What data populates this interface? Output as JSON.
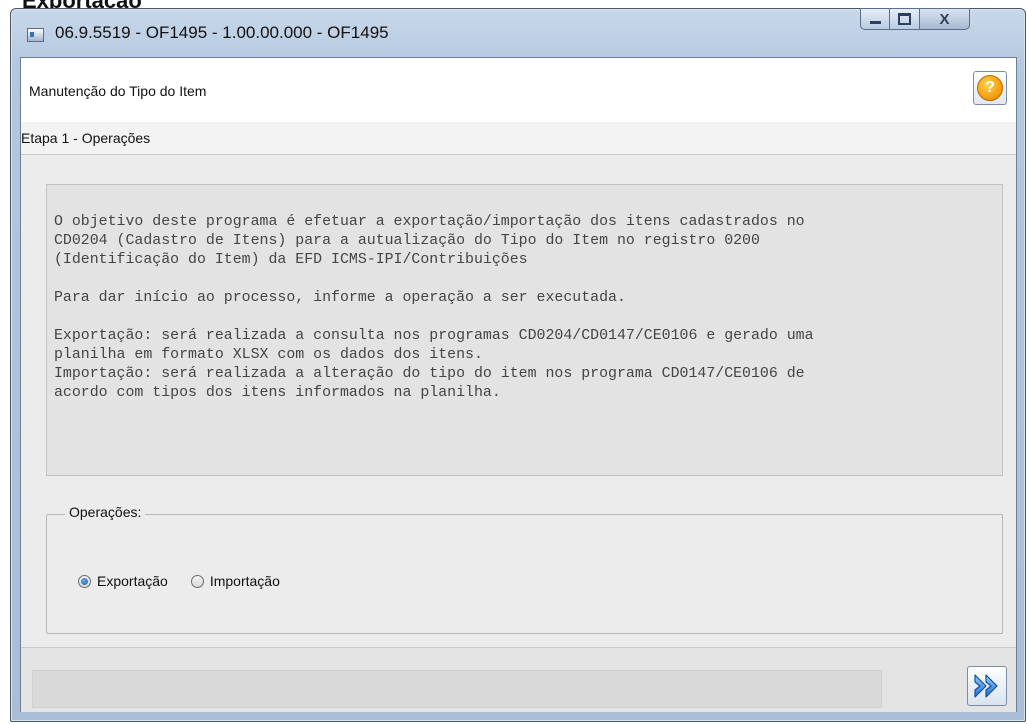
{
  "window": {
    "title": "06.9.5519 - OF1495 - 1.00.00.000 - OF1495",
    "minimize_glyph": "—",
    "maximize_glyph": "□",
    "close_glyph": "X"
  },
  "header": {
    "title": "Manutenção do Tipo do Item",
    "help_glyph": "?"
  },
  "step": {
    "label": "Etapa 1 - Operações"
  },
  "description": {
    "text": "O objetivo deste programa é efetuar a exportação/importação dos itens cadastrados no\nCD0204 (Cadastro de Itens) para a autualização do Tipo do Item no registro 0200\n(Identificação do Item) da EFD ICMS-IPI/Contribuições\n\nPara dar início ao processo, informe a operação a ser executada.\n\nExportação: será realizada a consulta nos programas CD0204/CD0147/CE0106 e gerado uma\nplanilha em formato XLSX com os dados dos itens.\nImportação: será realizada a alteração do tipo do item nos programa CD0147/CE0106 de\nacordo com tipos dos itens informados na planilha."
  },
  "operations": {
    "legend": "Operações:",
    "options": [
      {
        "label": "Exportação",
        "selected": true
      },
      {
        "label": "Importação",
        "selected": false
      }
    ]
  },
  "footer": {
    "status_text": ""
  },
  "colors": {
    "accent": "#1c5fb0",
    "help_icon": "#f19a0c"
  }
}
